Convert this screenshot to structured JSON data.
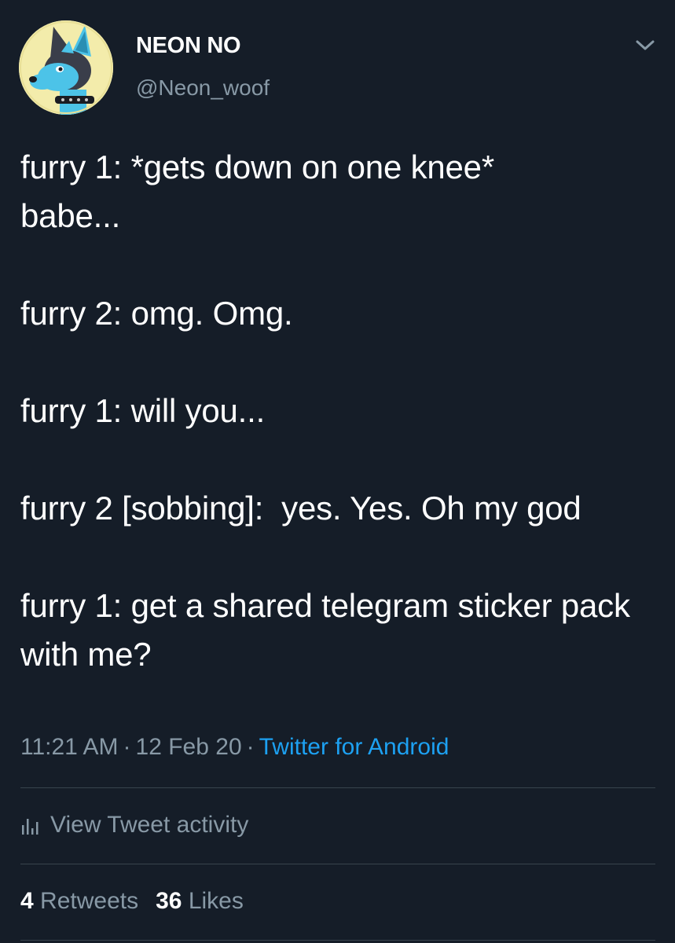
{
  "author": {
    "display_name": "NEON NO",
    "handle": "@Neon_woof"
  },
  "tweet": {
    "paragraphs": [
      "furry 1: *gets down on one knee*\nbabe...",
      "furry 2: omg. Omg.",
      "furry 1: will you...",
      "furry 2 [sobbing]:  yes. Yes. Oh my god",
      "furry 1: get a shared telegram sticker pack with me?"
    ],
    "time": "11:21 AM",
    "date": "12 Feb 20",
    "source": "Twitter for Android",
    "separator": "·"
  },
  "activity": {
    "label": "View Tweet activity"
  },
  "stats": {
    "retweets_count": "4",
    "retweets_label": "Retweets",
    "likes_count": "36",
    "likes_label": "Likes"
  },
  "colors": {
    "background": "#151d28",
    "text_primary": "#ffffff",
    "text_secondary": "#8899a6",
    "link": "#1da1f2",
    "divider": "#38444d",
    "avatar_bg": "#f3ecab"
  },
  "icons": {
    "chevron": "chevron-down-icon",
    "activity": "bar-chart-icon"
  }
}
